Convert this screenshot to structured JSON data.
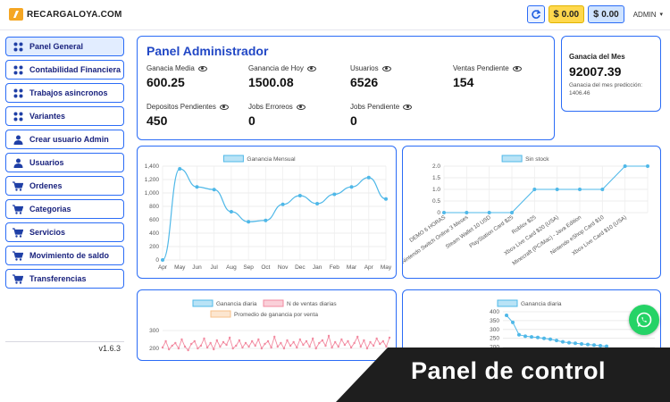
{
  "header": {
    "logo_text": "RECARGALOYA.COM",
    "balance_usd": "0.00",
    "balance_usd_symbol": "$",
    "balance_alt": "0.00",
    "balance_alt_symbol": "$",
    "user": "ADMIN"
  },
  "sidebar": {
    "items": [
      {
        "label": "Panel General",
        "icon": "grid-icon",
        "active": true
      },
      {
        "label": "Contabilidad Financiera",
        "icon": "grid-icon"
      },
      {
        "label": "Trabajos asincronos",
        "icon": "grid-icon"
      },
      {
        "label": "Variantes",
        "icon": "grid-icon"
      },
      {
        "label": "Crear usuario Admin",
        "icon": "user-icon"
      },
      {
        "label": "Usuarios",
        "icon": "user-icon"
      },
      {
        "label": "Ordenes",
        "icon": "cart-icon"
      },
      {
        "label": "Categorias",
        "icon": "cart-icon"
      },
      {
        "label": "Servicios",
        "icon": "cart-icon"
      },
      {
        "label": "Movimiento de saldo",
        "icon": "cart-icon"
      },
      {
        "label": "Transferencias",
        "icon": "cart-icon"
      }
    ],
    "version": "v1.6.3"
  },
  "panel": {
    "title": "Panel Administrador",
    "stats": [
      {
        "label": "Ganacia Media",
        "value": "600.25"
      },
      {
        "label": "Ganancia de Hoy",
        "value": "1500.08"
      },
      {
        "label": "Usuarios",
        "value": "6526"
      },
      {
        "label": "Ventas Pendiente",
        "value": "154"
      },
      {
        "label": "Depositos Pendientes",
        "value": "450"
      },
      {
        "label": "Jobs Erroreos",
        "value": "0"
      },
      {
        "label": "Jobs Pendiente",
        "value": "0"
      }
    ]
  },
  "month": {
    "label": "Ganacia del Mes",
    "value": "92007.39",
    "prediction": "Ganacia del mes predicción: 1406.46"
  },
  "banner": {
    "text": "Panel de control"
  },
  "colors": {
    "accent": "#2b6cf6",
    "line": "#4fb8e8",
    "pink": "#f28aa0",
    "orange": "#f7c08a",
    "whatsapp": "#25d366"
  },
  "chart_data": [
    {
      "type": "line",
      "legend": [
        "Ganancia Mensual"
      ],
      "categories": [
        "Apr",
        "May",
        "Jun",
        "Jul",
        "Aug",
        "Sep",
        "Oct",
        "Nov",
        "Dec",
        "Jan",
        "Feb",
        "Mar",
        "Apr",
        "May"
      ],
      "series": [
        {
          "name": "Ganancia Mensual",
          "values": [
            0,
            1360,
            1090,
            1050,
            720,
            570,
            590,
            830,
            960,
            840,
            980,
            1090,
            1230,
            910
          ]
        }
      ],
      "yticks": [
        "0",
        "200",
        "400",
        "600",
        "800",
        "1,000",
        "1,200",
        "1,400"
      ],
      "ylim": [
        0,
        1400
      ]
    },
    {
      "type": "line",
      "legend": [
        "Sin stock"
      ],
      "categories": [
        "DEMO 6 HORAS",
        "Nintendo Switch Online 3 Meses",
        "Steam Wallet 10 USD",
        "PlayStation Card $25",
        "Roblox $25",
        "Xbox Live Card $20 (USA)",
        "Minecraft (PC/Mac) - Java Edition",
        "Nintendo eShop Card $10",
        "Xbox Live Card $10 (USA)"
      ],
      "series": [
        {
          "name": "Sin stock",
          "values": [
            0,
            0,
            0,
            0,
            1,
            1,
            1,
            1,
            2,
            2
          ]
        }
      ],
      "yticks": [
        "0",
        "0.5",
        "1.0",
        "1.5",
        "2.0"
      ],
      "ylim": [
        0,
        2
      ]
    },
    {
      "type": "line",
      "legend": [
        "Ganancia diaria",
        "N de ventas diarias",
        "Promedio de ganancia por venta"
      ],
      "yticks": [
        "200",
        "300"
      ],
      "series": [
        {
          "name": "N de ventas diarias",
          "values": [
            205,
            240,
            195,
            215,
            230,
            200,
            250,
            210,
            190,
            225,
            240,
            200,
            215,
            255,
            205,
            230,
            195,
            245,
            210,
            235,
            220,
            260,
            200,
            215,
            245,
            205,
            230,
            210,
            240,
            215,
            250,
            200,
            225,
            240,
            205,
            265,
            210,
            230,
            200,
            245,
            215,
            235,
            205,
            250,
            220,
            240,
            210,
            255,
            200,
            230,
            245,
            215,
            270,
            205,
            235,
            210,
            250,
            220,
            240,
            205,
            230,
            265,
            210,
            245,
            200,
            235,
            215,
            255,
            225,
            240,
            210,
            260
          ]
        }
      ]
    },
    {
      "type": "line",
      "legend": [
        "Ganancia diaria"
      ],
      "yticks": [
        "200",
        "250",
        "300",
        "350",
        "400"
      ],
      "series": [
        {
          "name": "Ganancia diaria",
          "values": [
            380,
            340,
            270,
            262,
            258,
            255,
            250,
            245,
            238,
            230,
            225,
            222,
            218,
            215,
            212,
            208,
            205
          ]
        }
      ]
    }
  ]
}
